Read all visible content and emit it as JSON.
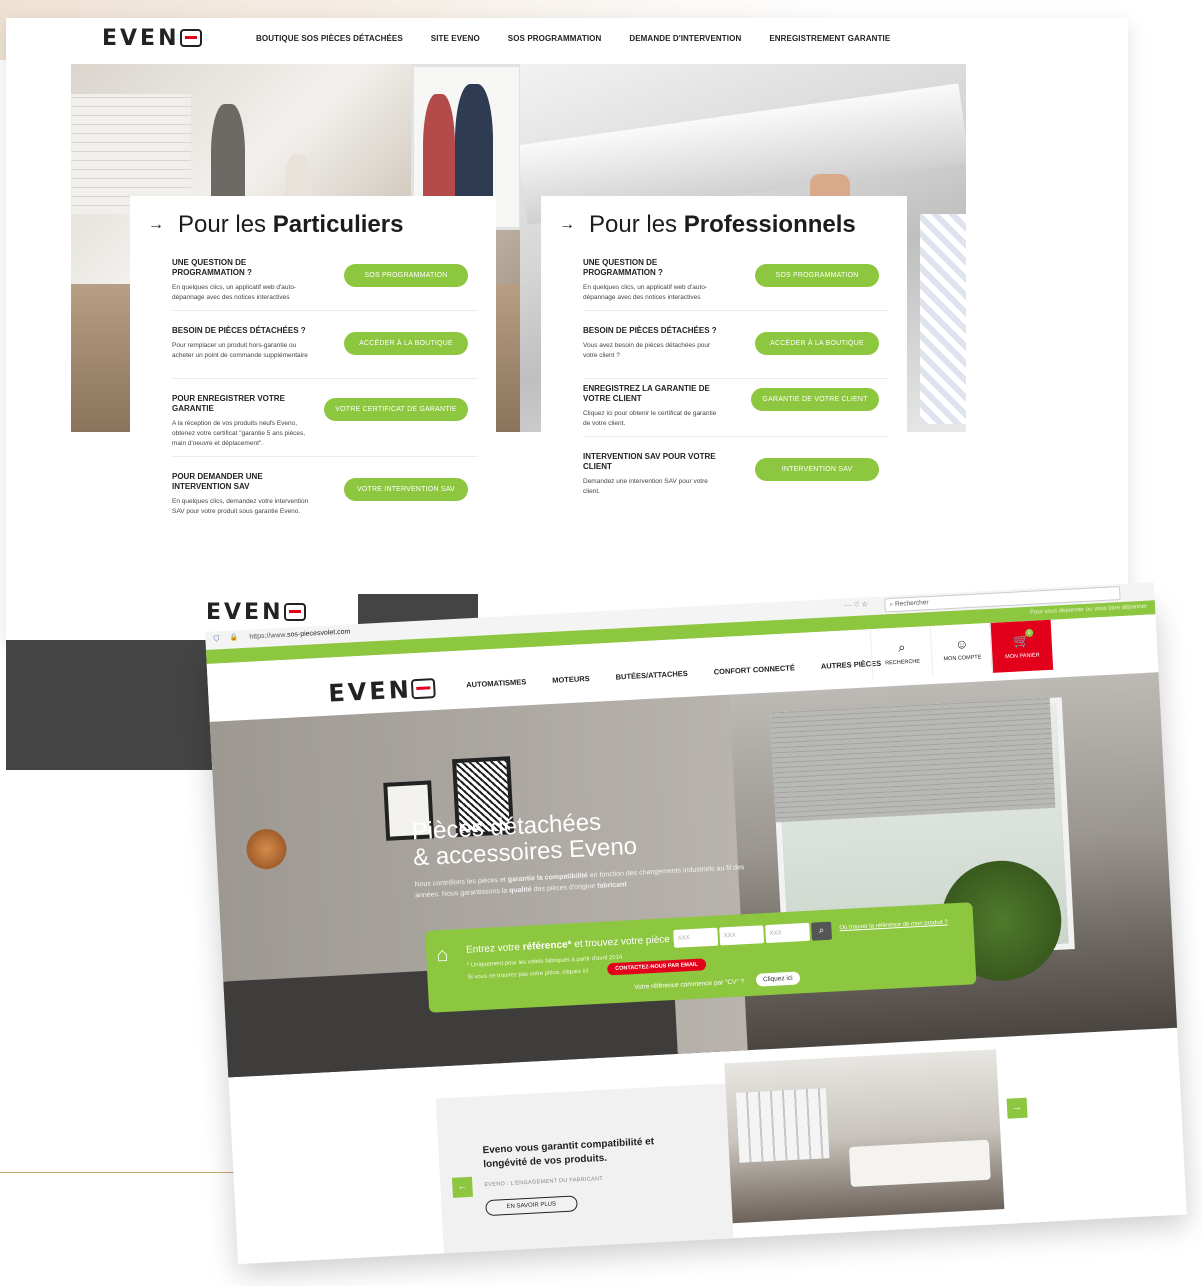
{
  "back_site": {
    "logo": "EVEN",
    "nav": [
      "BOUTIQUE SOS PIÈCES DÉTACHÉES",
      "SITE EVENO",
      "SOS PROGRAMMATION",
      "DEMANDE D'INTERVENTION",
      "ENREGISTREMENT GARANTIE"
    ],
    "particuliers": {
      "title_prefix": "Pour les ",
      "title_bold": "Particuliers",
      "rows": [
        {
          "title": "UNE QUESTION DE PROGRAMMATION ?",
          "desc": "En quelques clics, un applicatif web d'auto-dépannage avec des notices interactives",
          "button": "SOS PROGRAMMATION"
        },
        {
          "title": "BESOIN DE PIÈCES DÉTACHÉES ?",
          "desc": "Pour remplacer un produit hors-garantie ou acheter un point de commande supplémentaire",
          "button": "ACCÉDER À LA BOUTIQUE"
        },
        {
          "title": "POUR ENREGISTRER VOTRE GARANTIE",
          "desc": "A la réception de vos produits neufs Eveno, obtenez votre certificat \"garantie 5 ans pièces, main d'oeuvre et déplacement\".",
          "button": "VOTRE CERTIFICAT DE GARANTIE"
        },
        {
          "title": "POUR DEMANDER UNE INTERVENTION SAV",
          "desc": "En quelques clics, demandez votre intervention SAV pour votre produit sous garantie Eveno.",
          "button": "VOTRE INTERVENTION SAV"
        }
      ]
    },
    "professionnels": {
      "title_prefix": "Pour les ",
      "title_bold": "Professionnels",
      "rows": [
        {
          "title": "UNE QUESTION DE PROGRAMMATION ?",
          "desc": "En quelques clics, un applicatif web d'auto-dépannage avec des notices interactives",
          "button": "SOS PROGRAMMATION"
        },
        {
          "title": "BESOIN DE PIÈCES DÉTACHÉES ?",
          "desc": "Vous avez besoin de pièces détachées pour votre client ?",
          "button": "ACCÉDER À LA BOUTIQUE"
        },
        {
          "title": "ENREGISTREZ LA GARANTIE DE VOTRE CLIENT",
          "desc": "Cliquez ici pour obtenir le certificat de garantie de votre client.",
          "button": "GARANTIE DE VOTRE CLIENT"
        },
        {
          "title": "INTERVENTION SAV POUR VOTRE CLIENT",
          "desc": "Demandez une intervention SAV pour votre client.",
          "button": "INTERVENTION SAV"
        }
      ]
    },
    "footer_logo": "EVEN"
  },
  "front_site": {
    "url_prefix": "https://www.",
    "url_domain": "sos-piecesvolet.com",
    "browser_tools": "··· ♡ ☆",
    "search_placeholder": "Rechercher",
    "top_message": "Pour vous dépanner ou vous faire dépanner",
    "logo": "EVEN",
    "menu": [
      "AUTOMATISMES",
      "MOTEURS",
      "BUTÉES/ATTACHES",
      "CONFORT CONNECTÉ",
      "AUTRES PIÈCES"
    ],
    "search_label": "RECHERCHE",
    "account_label": "MON COMPTE",
    "cart_label": "MON PANIER",
    "cart_count": "0",
    "hero_title_1": "Pièces détachées",
    "hero_title_2": "& accessoires Eveno",
    "hero_sub_1": "Nous contrôlons les pièces et ",
    "hero_sub_bold_1": "garantie la compatibilité",
    "hero_sub_2": " en fonction des changements industriels au fil des années. Nous garantissons la ",
    "hero_sub_bold_2": "qualité",
    "hero_sub_3": " des pièces d'origine ",
    "hero_sub_bold_3": "fabricant",
    "ref_prompt_1": "Entrez votre ",
    "ref_prompt_bold": "référence*",
    "ref_prompt_2": " et trouvez votre pièce !",
    "ref_placeholder": "XXX",
    "ref_help": "Où trouver la référence de mon produit ?",
    "ref_note": "* Uniquement pour les volets fabriqués à partir d'avril 2014",
    "ref_note2": "Si vous ne trouvez pas votre pièce, cliquez ici",
    "email_button": "CONTACTEZ-NOUS PAR EMAIL",
    "cv_text": "Votre référence commence par \"CV\" ?",
    "cv_button": "Cliquez ici",
    "promo_title": "Eveno vous garantit compatibilité et longévité de vos produits.",
    "promo_sub": "EVENO : L'ENGAGEMENT DU FABRICANT",
    "promo_button": "EN SAVOIR PLUS"
  },
  "colors": {
    "accent_green": "#8dc63f",
    "brand_red": "#e3001b",
    "dark_band": "#444444"
  },
  "icons": [
    "arrow-right-icon",
    "search-icon",
    "user-icon",
    "cart-icon",
    "house-check-icon",
    "arrow-left-icon",
    "shield-icon",
    "lock-icon"
  ]
}
